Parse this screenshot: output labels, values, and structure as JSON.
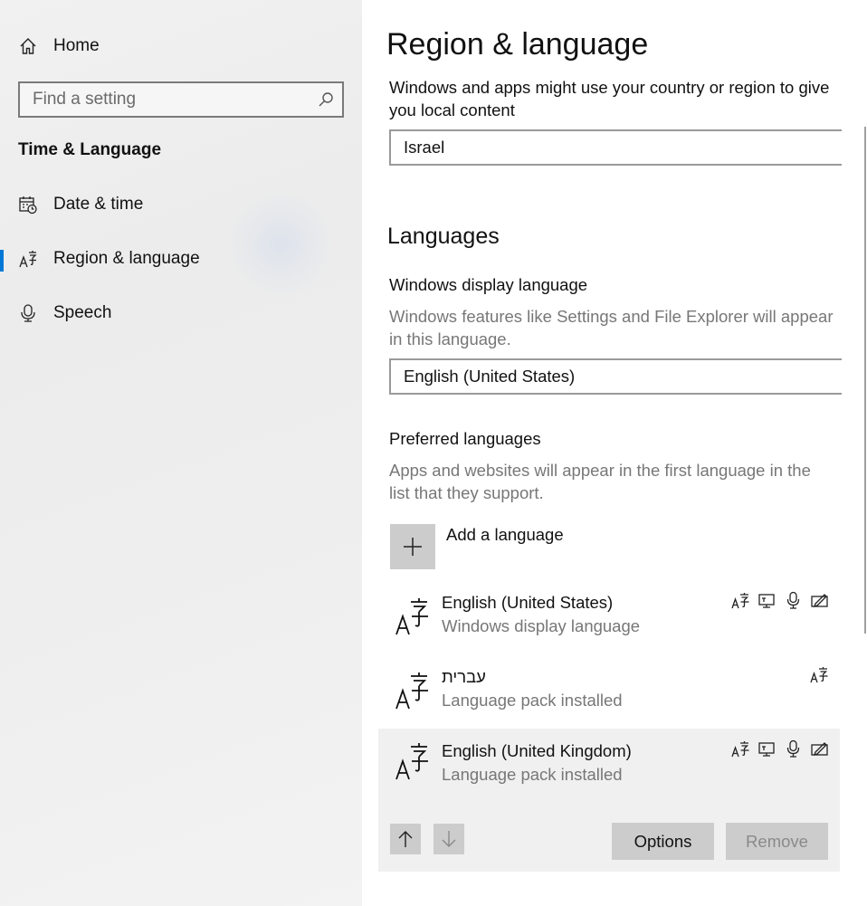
{
  "sidebar": {
    "home_label": "Home",
    "search_placeholder": "Find a setting",
    "section_title": "Time & Language",
    "items": [
      {
        "label": "Date & time",
        "icon": "calendar-clock-icon"
      },
      {
        "label": "Region & language",
        "icon": "language-icon",
        "selected": true
      },
      {
        "label": "Speech",
        "icon": "microphone-icon"
      }
    ]
  },
  "main": {
    "title": "Region & language",
    "country_description": "Windows and apps might use your country or region to give you local content",
    "country_value": "Israel",
    "languages_heading": "Languages",
    "display_language_label": "Windows display language",
    "display_language_description": "Windows features like Settings and File Explorer will appear in this language.",
    "display_language_value": "English (United States)",
    "preferred_label": "Preferred languages",
    "preferred_description": "Apps and websites will appear in the first language in the list that they support.",
    "add_language_label": "Add a language",
    "languages": [
      {
        "name": "English (United States)",
        "status": "Windows display language",
        "features": [
          "display-language-icon",
          "text-to-speech-icon",
          "speech-recognition-icon",
          "handwriting-icon"
        ]
      },
      {
        "name": "עברית",
        "status": "Language pack installed",
        "features": [
          "display-language-icon"
        ]
      },
      {
        "name": "English (United Kingdom)",
        "status": "Language pack installed",
        "features": [
          "display-language-icon",
          "text-to-speech-icon",
          "speech-recognition-icon",
          "handwriting-icon"
        ],
        "selected": true
      }
    ],
    "options_label": "Options",
    "remove_label": "Remove"
  },
  "colors": {
    "accent": "#0078d7",
    "button_bg": "#cccccc",
    "secondary_text": "#777777"
  }
}
